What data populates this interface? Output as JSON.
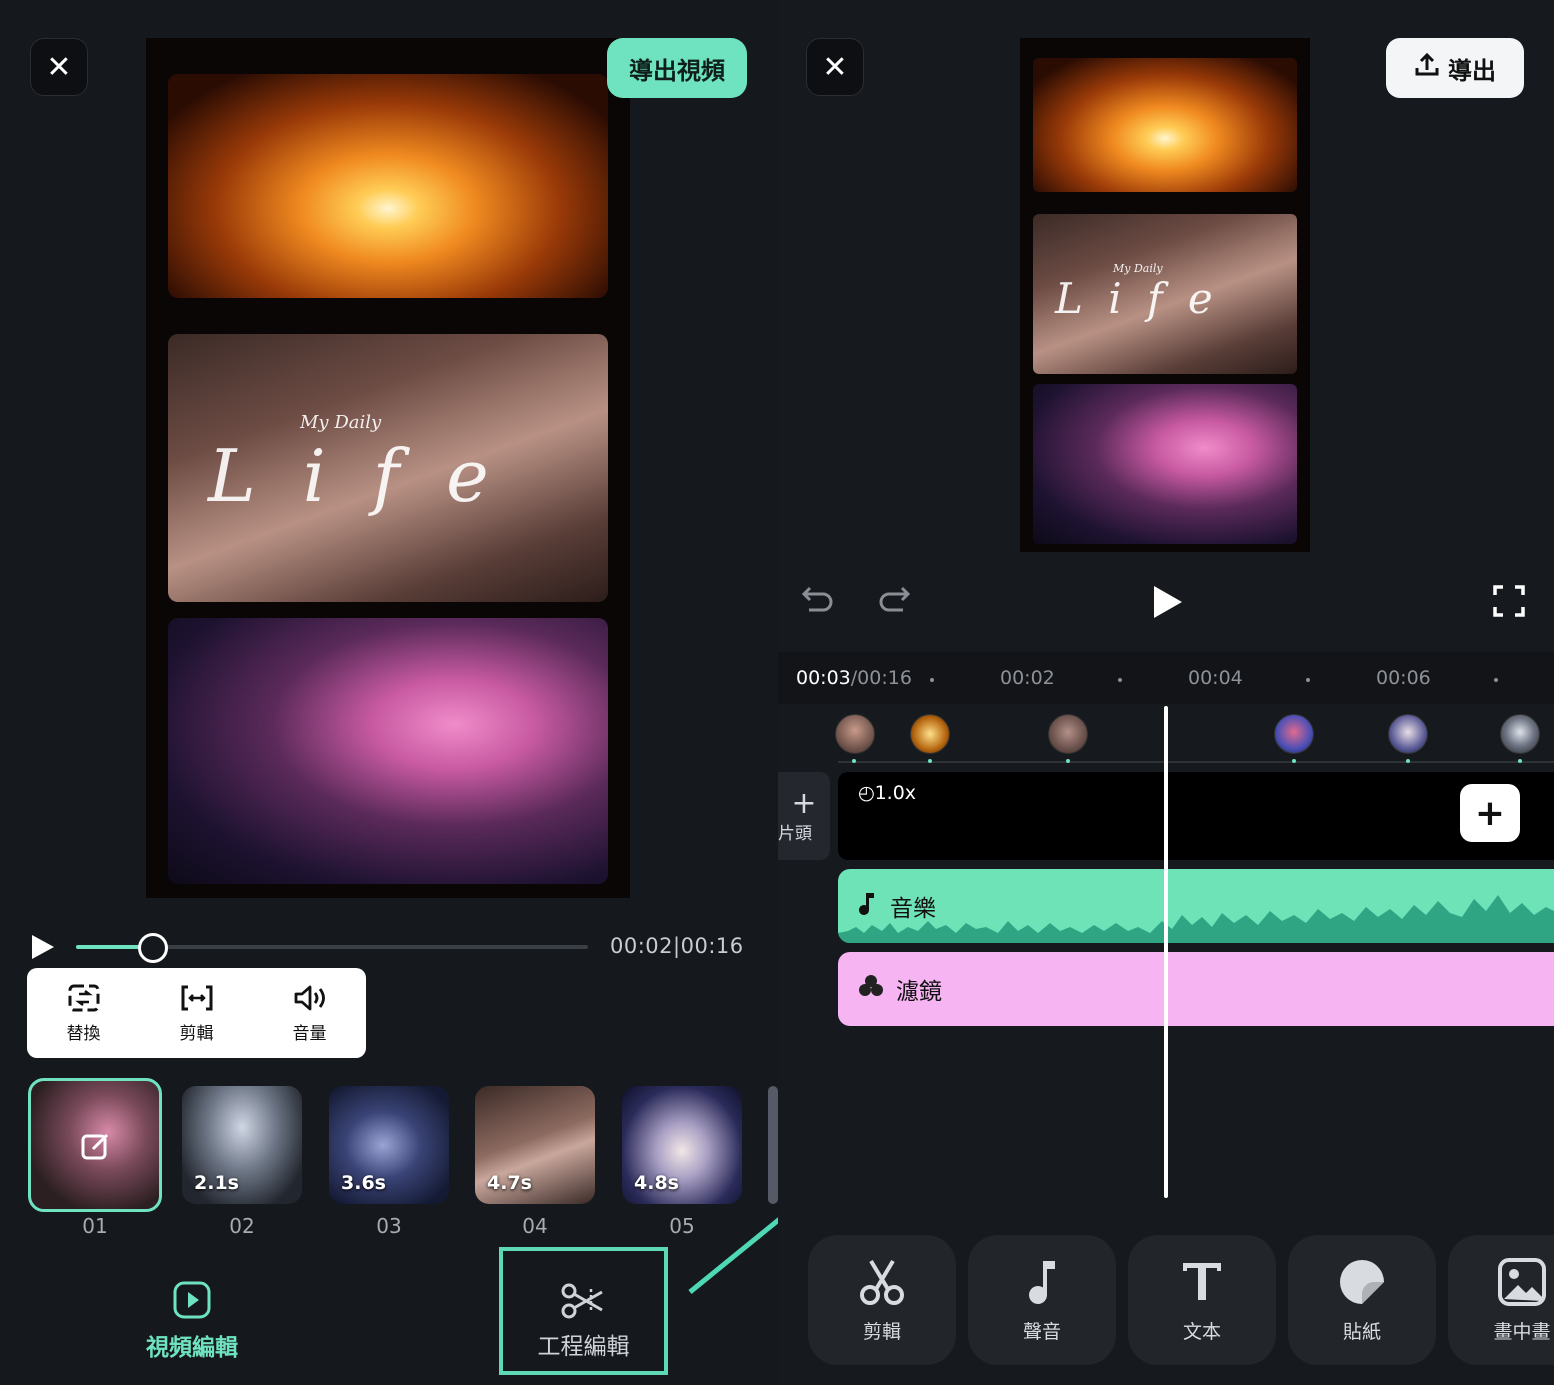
{
  "left": {
    "close_symbol": "✕",
    "export_video_label": "導出視頻",
    "overlay_small": "My Daily",
    "overlay_script": "L i f e",
    "current_time": "00:02",
    "separator": "|",
    "total_time": "00:16",
    "playback_progress": 0.145,
    "actions": [
      {
        "label": "替換",
        "icon": "replace-icon"
      },
      {
        "label": "剪輯",
        "icon": "trim-icon"
      },
      {
        "label": "音量",
        "icon": "volume-icon"
      }
    ],
    "clips": [
      {
        "num": "01",
        "duration": ""
      },
      {
        "num": "02",
        "duration": "2.1s"
      },
      {
        "num": "03",
        "duration": "3.6s"
      },
      {
        "num": "04",
        "duration": "4.7s"
      },
      {
        "num": "05",
        "duration": "4.8s"
      }
    ],
    "nav_video_label": "視頻編輯",
    "nav_project_label": "工程編輯"
  },
  "right": {
    "close_symbol": "✕",
    "export_label": "導出",
    "overlay_small": "My Daily",
    "overlay_script": "L i f e",
    "timecode_current": "00:03",
    "timecode_total": "/00:16",
    "ruler_labels": [
      "00:02",
      "00:04",
      "00:06"
    ],
    "add_head_label": "片頭",
    "speed_label": "1.0x",
    "music_label": "音樂",
    "filter_label": "濾鏡",
    "tools": [
      {
        "label": "剪輯",
        "icon": "scissors-icon"
      },
      {
        "label": "聲音",
        "icon": "music-note-icon"
      },
      {
        "label": "文本",
        "icon": "text-icon"
      },
      {
        "label": "貼紙",
        "icon": "sticker-icon"
      },
      {
        "label": "畫中畫",
        "icon": "picture-in-picture-icon"
      }
    ]
  },
  "colors": {
    "accent": "#6fe3c0",
    "music_track": "#6fe3b8",
    "filter_track": "#f7b4f3",
    "background": "#15181c"
  }
}
